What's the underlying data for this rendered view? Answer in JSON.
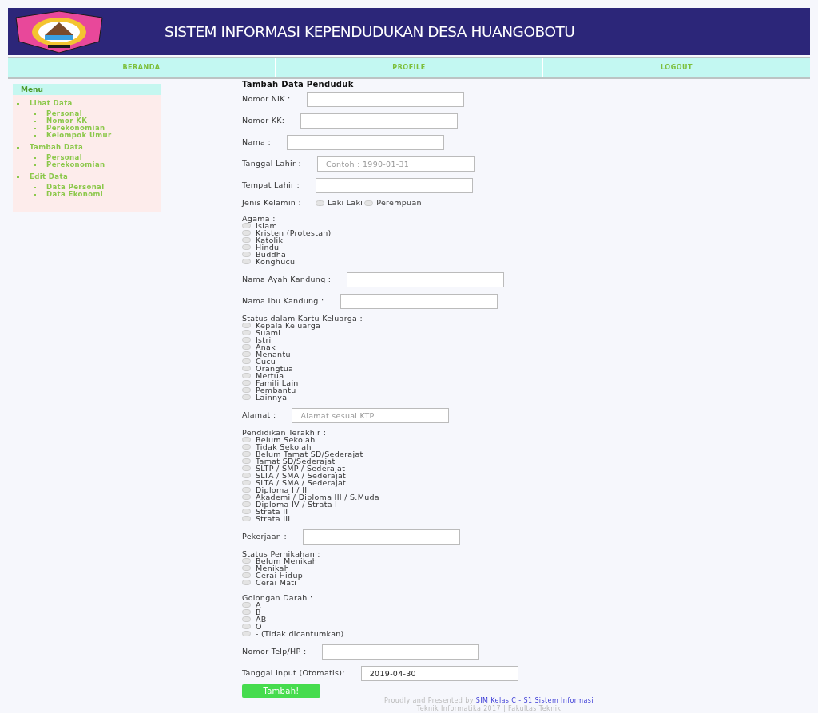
{
  "header": {
    "title": "SISTEM INFORMASI KEPENDUDUKAN DESA HUANGOBOTU"
  },
  "nav": [
    {
      "label": "BERANDA"
    },
    {
      "label": "PROFILE"
    },
    {
      "label": "LOGOUT"
    }
  ],
  "sidebar": {
    "title": "Menu",
    "items": [
      {
        "label": "Lihat Data",
        "children": [
          {
            "label": "Personal"
          },
          {
            "label": "Nomor KK"
          },
          {
            "label": "Perekonomian"
          },
          {
            "label": "Kelompok Umur"
          }
        ]
      },
      {
        "label": "Tambah Data",
        "children": [
          {
            "label": "Personal"
          },
          {
            "label": "Perekonomian"
          }
        ]
      },
      {
        "label": "Edit Data",
        "children": [
          {
            "label": "Data Personal"
          },
          {
            "label": "Data Ekonomi"
          }
        ]
      }
    ]
  },
  "form": {
    "title": "Tambah Data Penduduk",
    "fields": [
      {
        "kind": "text",
        "label": "Nomor NIK :"
      },
      {
        "kind": "text",
        "label": "Nomor KK:"
      },
      {
        "kind": "text",
        "label": "Nama :"
      },
      {
        "kind": "text",
        "label": "Tanggal Lahir :",
        "placeholder": "Contoh : 1990-01-31"
      },
      {
        "kind": "text",
        "label": "Tempat Lahir :"
      },
      {
        "kind": "inline-radio",
        "label": "Jenis Kelamin :",
        "options": [
          {
            "label": "Laki Laki",
            "selected": false
          },
          {
            "label": "Perempuan",
            "selected": false
          }
        ]
      },
      {
        "kind": "radio",
        "label": "Agama :",
        "options": [
          {
            "label": "Islam",
            "selected": false
          },
          {
            "label": "Kristen (Protestan)",
            "selected": false
          },
          {
            "label": "Katolik",
            "selected": false
          },
          {
            "label": "Hindu",
            "selected": false
          },
          {
            "label": "Buddha",
            "selected": false
          },
          {
            "label": "Konghucu",
            "selected": false
          }
        ]
      },
      {
        "kind": "text",
        "label": "Nama Ayah Kandung :"
      },
      {
        "kind": "text",
        "label": "Nama Ibu Kandung :"
      },
      {
        "kind": "radio",
        "label": "Status dalam Kartu Keluarga :",
        "options": [
          {
            "label": "Kepala Keluarga",
            "selected": false
          },
          {
            "label": "Suami",
            "selected": false
          },
          {
            "label": "Istri",
            "selected": false
          },
          {
            "label": "Anak",
            "selected": false
          },
          {
            "label": "Menantu",
            "selected": false
          },
          {
            "label": "Cucu",
            "selected": false
          },
          {
            "label": "Orangtua",
            "selected": false
          },
          {
            "label": "Mertua",
            "selected": false
          },
          {
            "label": "Famili Lain",
            "selected": false
          },
          {
            "label": "Pembantu",
            "selected": false
          },
          {
            "label": "Lainnya",
            "selected": false
          }
        ]
      },
      {
        "kind": "text",
        "label": "Alamat :",
        "placeholder": "Alamat sesuai KTP"
      },
      {
        "kind": "radio",
        "label": "Pendidikan Terakhir :",
        "options": [
          {
            "label": "Belum Sekolah",
            "selected": false
          },
          {
            "label": "Tidak Sekolah",
            "selected": false
          },
          {
            "label": "Belum Tamat SD/Sederajat",
            "selected": false
          },
          {
            "label": "Tamat SD/Sederajat",
            "selected": false
          },
          {
            "label": "SLTP / SMP / Sederajat",
            "selected": false
          },
          {
            "label": "SLTA / SMA / Sederajat",
            "selected": false
          },
          {
            "label": "SLTA / SMA / Sederajat",
            "selected": false
          },
          {
            "label": "Diploma I / II",
            "selected": false
          },
          {
            "label": "Akademi / Diploma III / S.Muda",
            "selected": false
          },
          {
            "label": "Diploma IV / Strata I",
            "selected": false
          },
          {
            "label": "Strata II",
            "selected": false
          },
          {
            "label": "Strata III",
            "selected": false
          }
        ]
      },
      {
        "kind": "text",
        "label": "Pekerjaan :"
      },
      {
        "kind": "radio",
        "label": "Status Pernikahan :",
        "options": [
          {
            "label": "Belum Menikah",
            "selected": false
          },
          {
            "label": "Menikah",
            "selected": false
          },
          {
            "label": "Cerai Hidup",
            "selected": false
          },
          {
            "label": "Cerai Mati",
            "selected": false
          }
        ]
      },
      {
        "kind": "radio",
        "label": "Golongan Darah :",
        "options": [
          {
            "label": "A",
            "selected": false
          },
          {
            "label": "B",
            "selected": false
          },
          {
            "label": "AB",
            "selected": false
          },
          {
            "label": "O",
            "selected": false
          },
          {
            "label": "- (Tidak dicantumkan)",
            "selected": false
          }
        ]
      },
      {
        "kind": "text",
        "label": "Nomor Telp/HP :"
      },
      {
        "kind": "text",
        "label": "Tanggal Input (Otomatis):",
        "value": "2019-04-30"
      }
    ],
    "submit": "Tambah!"
  },
  "footer": {
    "text": "Proudly and Presented by",
    "link": "SIM Kelas C - S1 Sistem Informasi",
    "line2": "Teknik Informatika 2017 | Fakultas Teknik"
  }
}
